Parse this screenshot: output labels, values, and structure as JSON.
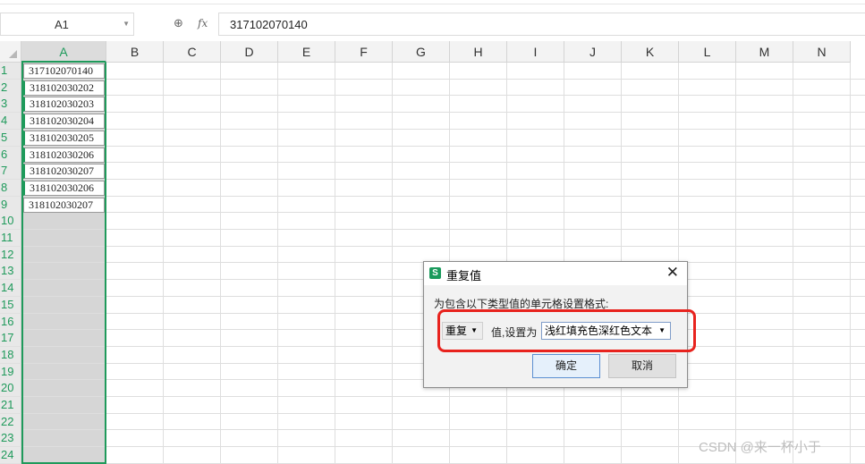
{
  "formula_bar": {
    "cell_ref": "A1",
    "fx_label": "fx",
    "formula_value": "317102070140"
  },
  "columns": [
    "A",
    "B",
    "C",
    "D",
    "E",
    "F",
    "G",
    "H",
    "I",
    "J",
    "K",
    "L",
    "M",
    "N"
  ],
  "rows": [
    "1",
    "2",
    "3",
    "4",
    "5",
    "6",
    "7",
    "8",
    "9",
    "10",
    "11",
    "12",
    "13",
    "14",
    "15",
    "16",
    "17",
    "18",
    "19",
    "20",
    "21",
    "22",
    "23",
    "24"
  ],
  "column_a_values": [
    "317102070140",
    "318102030202",
    "318102030203",
    "318102030204",
    "318102030205",
    "318102030206",
    "318102030207",
    "318102030206",
    "318102030207"
  ],
  "dialog": {
    "icon_letter": "S",
    "title": "重复值",
    "description": "为包含以下类型值的单元格设置格式:",
    "type_select": "重复",
    "middle_text": "值,设置为",
    "format_select": "浅红填充色深红色文本",
    "ok_label": "确定",
    "cancel_label": "取消"
  },
  "watermark": "CSDN @来一杯小于",
  "colors": {
    "accent_green": "#1f9a5b",
    "highlight_red": "#e8231e"
  }
}
